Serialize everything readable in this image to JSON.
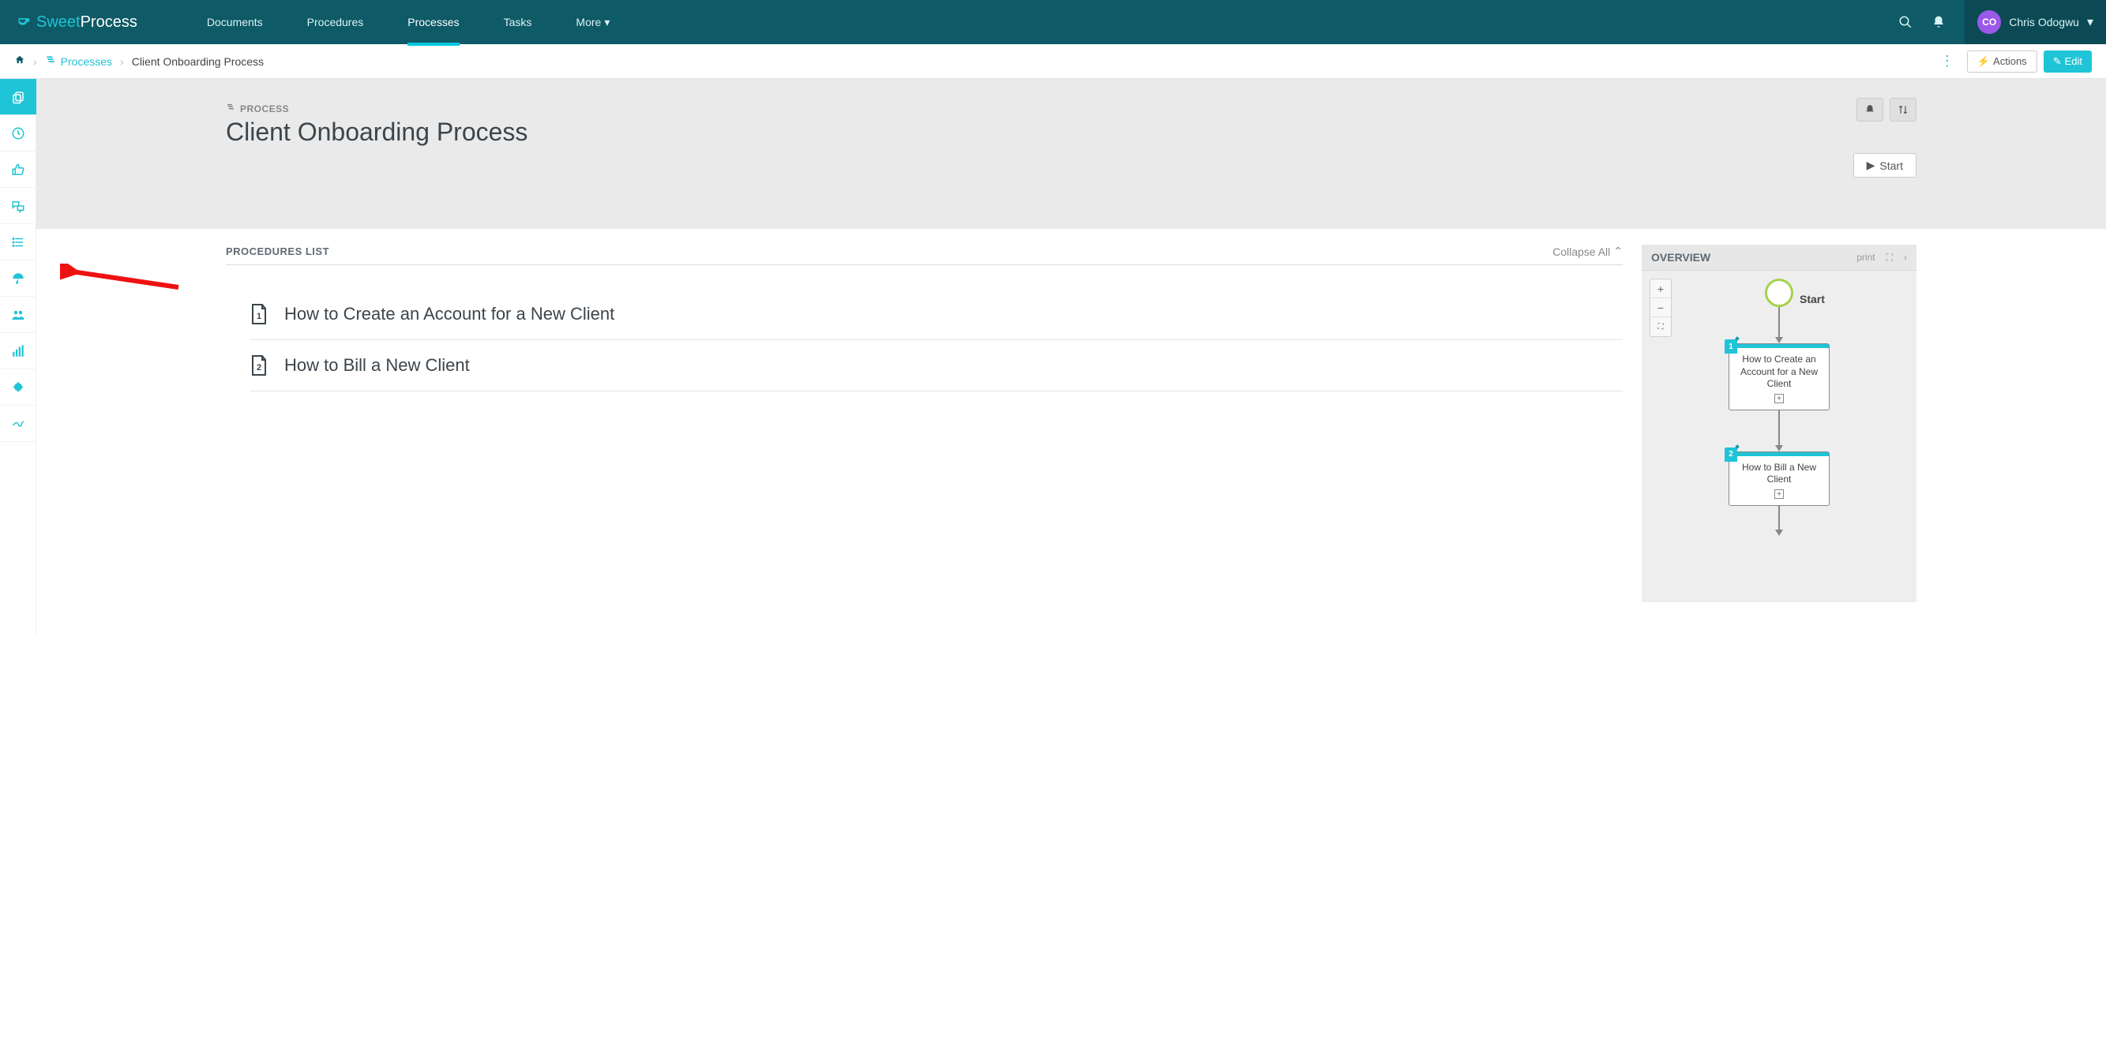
{
  "brand": {
    "sweet": "Sweet",
    "process": "Process"
  },
  "nav": {
    "items": [
      "Documents",
      "Procedures",
      "Processes",
      "Tasks",
      "More"
    ],
    "activeIndex": 2
  },
  "user": {
    "initials": "CO",
    "name": "Chris Odogwu"
  },
  "breadcrumb": {
    "link": "Processes",
    "current": "Client Onboarding Process"
  },
  "toolbar": {
    "actions": "Actions",
    "edit": "Edit"
  },
  "header": {
    "type": "PROCESS",
    "title": "Client Onboarding Process",
    "start": "Start"
  },
  "proclist": {
    "label": "PROCEDURES LIST",
    "collapse": "Collapse All",
    "items": [
      {
        "num": "1",
        "title": "How to Create an Account for a New Client"
      },
      {
        "num": "2",
        "title": "How to Bill a New Client"
      }
    ]
  },
  "overview": {
    "label": "OVERVIEW",
    "print": "print",
    "start": "Start",
    "steps": [
      {
        "num": "1",
        "text": "How to Create an Account for a New Client"
      },
      {
        "num": "2",
        "text": "How to Bill a New Client"
      }
    ]
  }
}
